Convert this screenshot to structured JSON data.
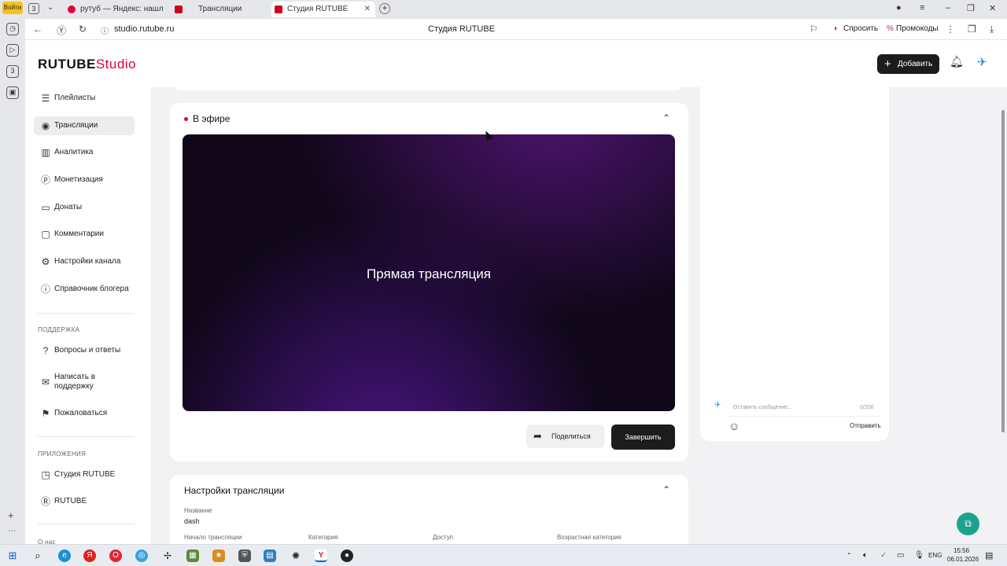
{
  "browser": {
    "rail_badge": "Войти",
    "tabs": [
      {
        "label": "рутуб — Яндекс: нашлось"
      },
      {
        "label": "Трансляции"
      },
      {
        "label": "Студия RUTUBE"
      }
    ],
    "url": "studio.rutube.ru",
    "page_title": "Студия RUTUBE",
    "ask_label": "Спросить",
    "promo_label": "Промокоды"
  },
  "header": {
    "logo_main": "RUTUBE",
    "logo_studio": "Studio",
    "add_label": "Добавить"
  },
  "sidebar": {
    "items": [
      {
        "label": "Плейлисты",
        "icon": "playlist-icon"
      },
      {
        "label": "Трансляции",
        "icon": "broadcast-icon"
      },
      {
        "label": "Аналитика",
        "icon": "analytics-icon"
      },
      {
        "label": "Монетизация",
        "icon": "monetization-icon"
      },
      {
        "label": "Донаты",
        "icon": "wallet-icon"
      },
      {
        "label": "Комментарии",
        "icon": "comments-icon"
      },
      {
        "label": "Настройки канала",
        "icon": "settings-icon"
      },
      {
        "label": "Справочник блогера",
        "icon": "info-icon"
      }
    ],
    "support_title": "ПОДДЕРЖКА",
    "support_items": [
      {
        "label": "Вопросы и ответы"
      },
      {
        "label": "Написать в поддержку"
      },
      {
        "label": "Пожаловаться"
      }
    ],
    "apps_title": "ПРИЛОЖЕНИЯ",
    "apps_items": [
      {
        "label": "Студия RUTUBE"
      },
      {
        "label": "RUTUBE"
      }
    ],
    "about": "О нас"
  },
  "live": {
    "title": "В эфире",
    "player_title": "Прямая трансляция",
    "share_label": "Поделиться",
    "finish_label": "Завершить"
  },
  "settings": {
    "title": "Настройки трансляции",
    "name_label": "Название",
    "name_value": "dash",
    "start_label": "Начало трансляции",
    "category_label": "Категория",
    "access_label": "Доступ",
    "age_label": "Возрастная категория"
  },
  "chat": {
    "placeholder": "Оставить сообщение...",
    "counter": "0/200",
    "send_label": "Отправить"
  },
  "taskbar": {
    "lang": "ENG",
    "time": "15:56",
    "date": "06.01.2026"
  },
  "colors": {
    "brand_red": "#e2003c",
    "dark_button": "#1c1c1c",
    "help_teal": "#1aa38f"
  }
}
